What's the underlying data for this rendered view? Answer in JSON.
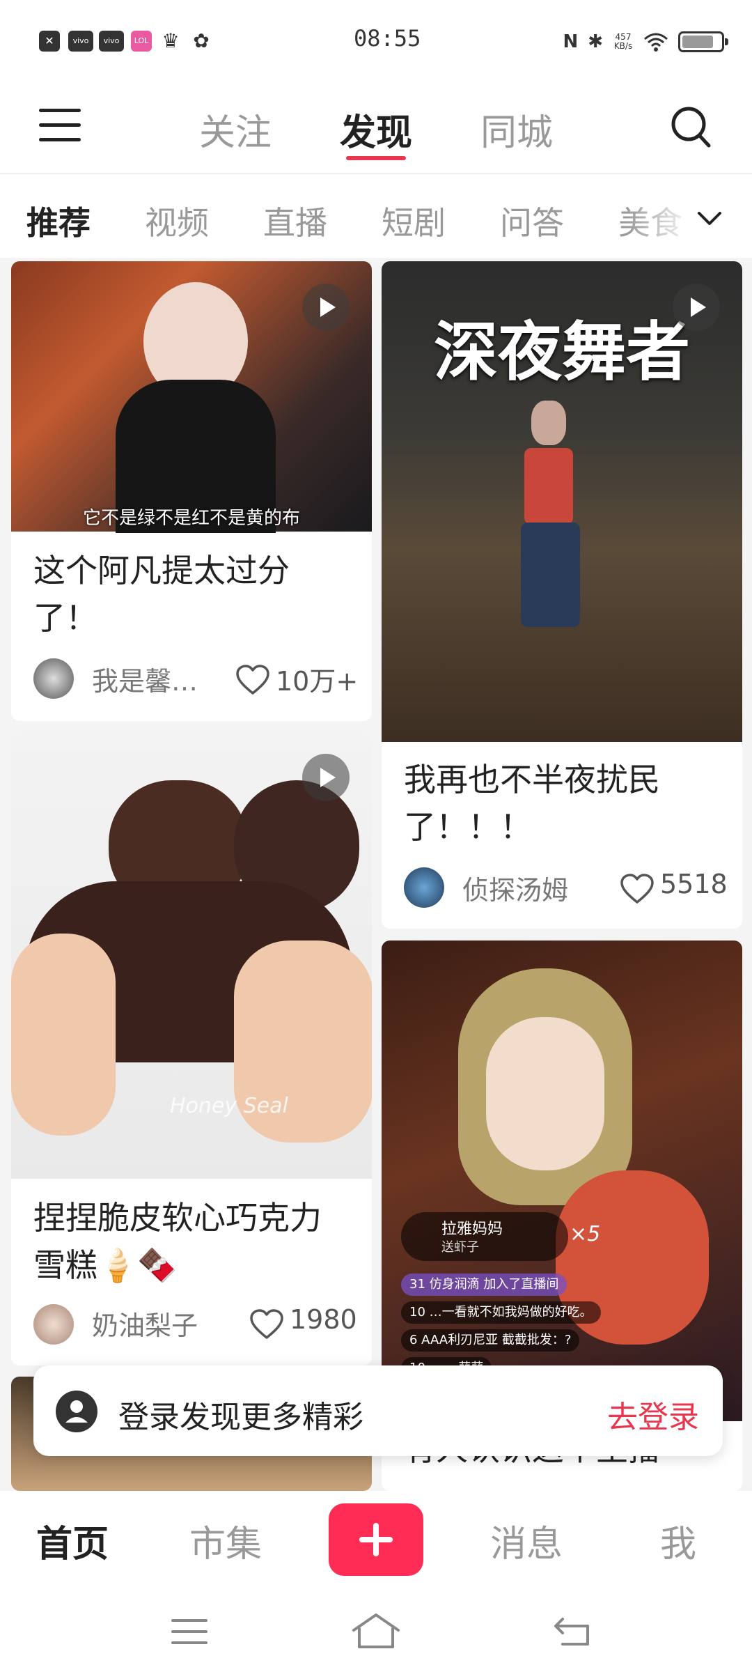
{
  "status_bar": {
    "time": "08:55",
    "speed_value": "457",
    "speed_unit": "KB/s",
    "left_icons": [
      "close-app-icon",
      "vivo-icon",
      "vivo-icon",
      "app-badge-icon",
      "crown-icon",
      "flower-icon"
    ]
  },
  "header": {
    "tabs": [
      {
        "label": "关注",
        "active": false
      },
      {
        "label": "发现",
        "active": true
      },
      {
        "label": "同城",
        "active": false
      }
    ]
  },
  "categories": [
    {
      "label": "推荐",
      "active": true
    },
    {
      "label": "视频",
      "active": false
    },
    {
      "label": "直播",
      "active": false
    },
    {
      "label": "短剧",
      "active": false
    },
    {
      "label": "问答",
      "active": false
    },
    {
      "label": "美食",
      "active": false
    }
  ],
  "cards": [
    {
      "title": "这个阿凡提太过分了！",
      "subtitle": "它不是绿不是红不是黄的布",
      "author": "我是馨…",
      "likes": "10万+"
    },
    {
      "title": "我再也不半夜扰民了！！！",
      "overlay_text": "深夜舞者",
      "author": "侦探汤姆",
      "likes": "5518"
    },
    {
      "title": "捏捏脆皮软心巧克力雪糕🍦🍫",
      "watermark": "Honey Seal",
      "author": "奶油梨子",
      "likes": "1980"
    },
    {
      "title": "有人认识这个主播",
      "live_badge": "拉雅妈妈",
      "live_sub": "送虾子",
      "live_count": "×5",
      "comments": [
        "31 仿身润滴 加入了直播间",
        "10 …一看就不如我妈做的好吃。",
        "6 AAA利刃尼亚 截截批发：?",
        "10 …… 蒜蒜"
      ]
    }
  ],
  "login_bar": {
    "text": "登录发现更多精彩",
    "button": "去登录"
  },
  "bottom_nav": {
    "home": "首页",
    "market": "市集",
    "messages": "消息",
    "me": "我"
  }
}
